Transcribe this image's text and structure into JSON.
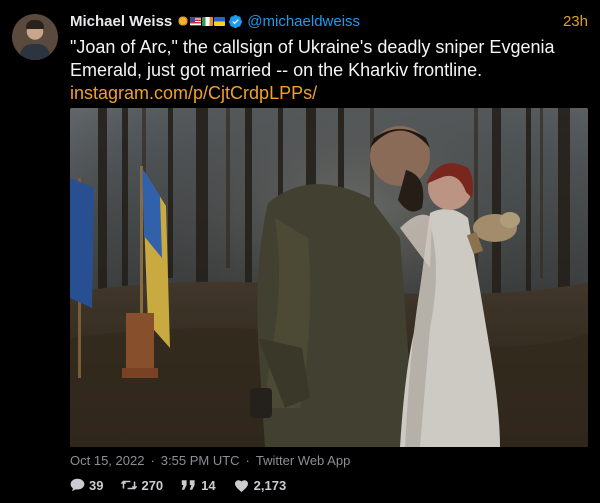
{
  "tweet": {
    "author_name": "Michael Weiss",
    "author_handle": "@michaeldweiss",
    "relative_time": "23h",
    "body": "\"Joan of Arc,\" the callsign of Ukraine's deadly sniper Evgenia Emerald, just got married -- on the Kharkiv frontline.",
    "link": "instagram.com/p/CjtCrdpLPPs/",
    "date": "Oct 15, 2022",
    "clock": "3:55 PM UTC",
    "separator": "·",
    "source": "Twitter Web App",
    "stats": {
      "replies": "39",
      "retweets": "270",
      "quotes": "14",
      "likes": "2,173"
    }
  },
  "icons": {
    "reply": "speech-bubble-icon",
    "retweet": "retweet-icon",
    "quote": "quote-icon",
    "like": "heart-icon",
    "verified": "verified-badge-icon"
  },
  "colors": {
    "background": "#000000",
    "handle": "#1d9bf0",
    "link": "#f0a030",
    "time": "#e0a020",
    "meta": "#8b8f94"
  }
}
